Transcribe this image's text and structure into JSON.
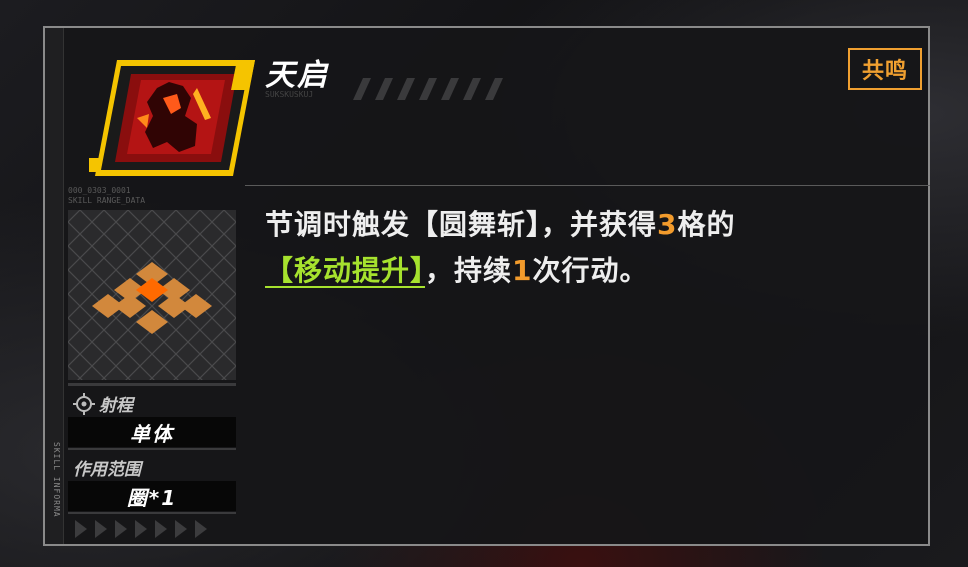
{
  "skill": {
    "title": "天启",
    "subtitle_code": "SUKSKUSKUJ",
    "badge": "共鸣",
    "description": {
      "p1": "节调时触发【圆舞斩】，并获得",
      "n1": "3",
      "p2": "格的",
      "keyword": "【移动提升】",
      "p3": "，持续",
      "n2": "1",
      "p4": "次行动。"
    }
  },
  "range_panel": {
    "meta_line1": "000_0303_0001",
    "meta_line2": "SKILL RANGE_DATA",
    "range_label": "射程",
    "range_value": "单体",
    "area_label": "作用范围",
    "area_value": "圈*1"
  },
  "side_text": "SKILL INFORMA",
  "colors": {
    "accent_orange": "#f29b2c",
    "keyword_green": "#a6e22e",
    "icon_frame_yellow": "#f5c400"
  }
}
